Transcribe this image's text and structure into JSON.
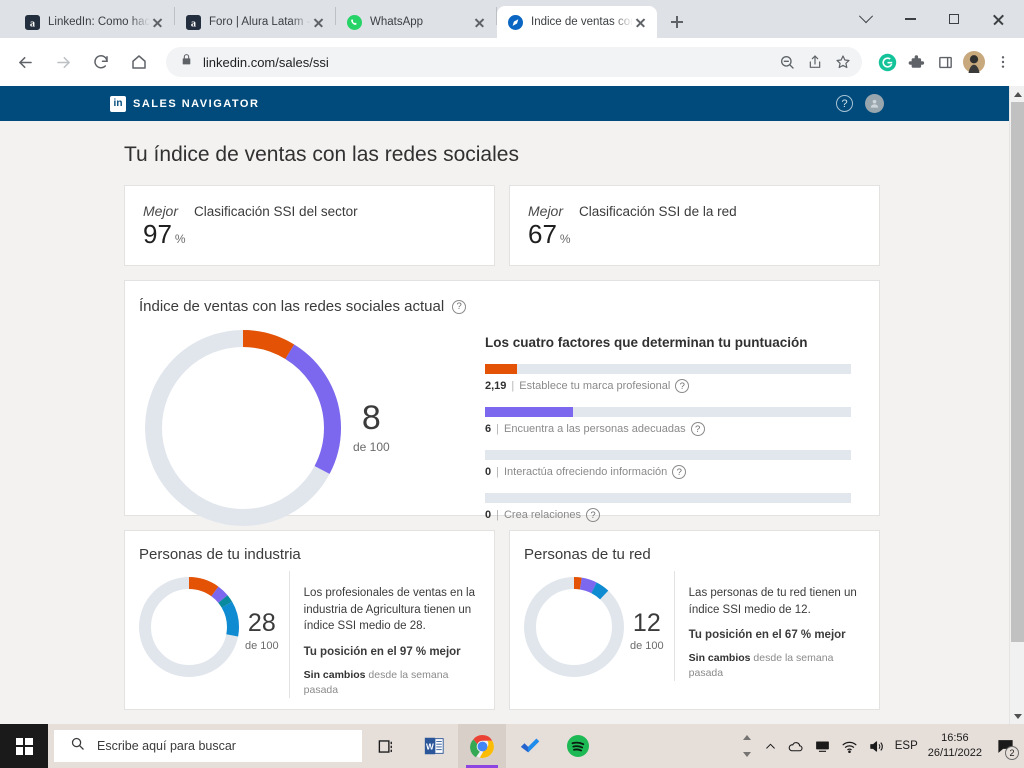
{
  "browser": {
    "tabs": [
      {
        "title": "LinkedIn: Como hacer c",
        "favicon": "amazon-a-icon",
        "active": false
      },
      {
        "title": "Foro | Alura Latam - Cu",
        "favicon": "amazon-a-icon",
        "active": false
      },
      {
        "title": "WhatsApp",
        "favicon": "whatsapp-icon",
        "active": false
      },
      {
        "title": "Índice de ventas con la",
        "favicon": "linkedin-sales-icon",
        "active": true
      }
    ],
    "window_controls": {
      "tab_search": "tab-search-chevron",
      "minimize": "minimize",
      "maximize": "maximize",
      "close": "close"
    },
    "nav": {
      "back": "back-arrow",
      "forward": "forward-arrow",
      "reload": "reload",
      "home": "home"
    },
    "omnibox": {
      "lock": "lock-icon",
      "url": "linkedin.com/sales/ssi"
    },
    "omnibox_icons": [
      "zoom-out-icon",
      "share-icon",
      "bookmark-star-icon"
    ],
    "extension_icons": [
      "grammarly-icon",
      "extensions-puzzle-icon",
      "sidepanel-icon",
      "profile-avatar",
      "chrome-menu-icon"
    ]
  },
  "sales_navigator": {
    "brand": "SALES NAVIGATOR",
    "logo_text": "in",
    "help_icon": "question-mark-icon",
    "account_icon": "account-avatar-icon"
  },
  "page": {
    "title": "Tu índice de ventas con las redes sociales",
    "rankings": [
      {
        "mejor": "Mejor",
        "label": "Clasificación SSI del sector",
        "value": "97",
        "unit": "%"
      },
      {
        "mejor": "Mejor",
        "label": "Clasificación SSI de la red",
        "value": "67",
        "unit": "%"
      }
    ],
    "ssi": {
      "heading": "Índice de ventas con las redes sociales actual",
      "help_icon": "question-mark-icon",
      "score": "8",
      "score_of": "de 100",
      "factors_heading": "Los cuatro factores que determinan tu puntuación",
      "factors": [
        {
          "value": "2,19",
          "sep": "|",
          "label": "Establece tu marca profesional",
          "color": "#e35205",
          "pct": 8.75,
          "help_icon": "question-mark-icon"
        },
        {
          "value": "6",
          "sep": "|",
          "label": "Encuentra a las personas adecuadas",
          "color": "#7b68ee",
          "pct": 24,
          "help_icon": "question-mark-icon"
        },
        {
          "value": "0",
          "sep": "|",
          "label": "Interactúa ofreciendo información",
          "color": "#0a8a9f",
          "pct": 0,
          "help_icon": "question-mark-icon"
        },
        {
          "value": "0",
          "sep": "|",
          "label": "Crea relaciones",
          "color": "#0f8bd1",
          "pct": 0,
          "help_icon": "question-mark-icon"
        }
      ]
    },
    "people": [
      {
        "heading": "Personas de tu industria",
        "score": "28",
        "score_of": "de 100",
        "line1": "Los profesionales de ventas en la industria de Agricultura tienen un índice SSI medio de 28.",
        "line2": "Tu posición en el 97 % mejor",
        "line3_bold": "Sin cambios",
        "line3_rest": " desde la semana pasada",
        "segments": [
          {
            "color": "#e35205",
            "pct": 10
          },
          {
            "color": "#7b68ee",
            "pct": 4
          },
          {
            "color": "#0a8a9f",
            "pct": 2.5
          },
          {
            "color": "#0f8bd1",
            "pct": 11.5
          }
        ]
      },
      {
        "heading": "Personas de tu red",
        "score": "12",
        "score_of": "de 100",
        "line1": "Las personas de tu red tienen un índice SSI medio de 12.",
        "line2": "Tu posición en el 67 % mejor",
        "line3_bold": "Sin cambios",
        "line3_rest": " desde la semana pasada",
        "segments": [
          {
            "color": "#e35205",
            "pct": 2.5
          },
          {
            "color": "#7b68ee",
            "pct": 5
          },
          {
            "color": "#0f8bd1",
            "pct": 4.5
          }
        ]
      }
    ]
  },
  "chart_data": [
    {
      "type": "pie",
      "title": "Índice de ventas con las redes sociales actual",
      "total_label": "de 100",
      "center_value": 8,
      "ylim": [
        0,
        100
      ],
      "categories": [
        "Establece tu marca profesional",
        "Encuentra a las personas adecuadas",
        "Interactúa ofreciendo información",
        "Crea relaciones",
        "Restante"
      ],
      "values": [
        2.19,
        6,
        0,
        0,
        91.81
      ],
      "colors": [
        "#e35205",
        "#7b68ee",
        "#0a8a9f",
        "#0f8bd1",
        "#dfe4ea"
      ]
    },
    {
      "type": "bar",
      "title": "Los cuatro factores que determinan tu puntuación",
      "categories": [
        "Establece tu marca profesional",
        "Encuentra a las personas adecuadas",
        "Interactúa ofreciendo información",
        "Crea relaciones"
      ],
      "values": [
        2.19,
        6,
        0,
        0
      ],
      "xlabel": "",
      "ylabel": "",
      "ylim": [
        0,
        25
      ],
      "colors": [
        "#e35205",
        "#7b68ee",
        "#0a8a9f",
        "#0f8bd1"
      ],
      "grid": false,
      "legend": "none"
    },
    {
      "type": "pie",
      "title": "Personas de tu industria",
      "center_value": 28,
      "total_label": "de 100",
      "categories": [
        "Establece tu marca profesional",
        "Encuentra a las personas adecuadas",
        "Interactúa ofreciendo información",
        "Crea relaciones",
        "Restante"
      ],
      "values": [
        10,
        4,
        2.5,
        11.5,
        72
      ],
      "colors": [
        "#e35205",
        "#7b68ee",
        "#0a8a9f",
        "#0f8bd1",
        "#dfe4ea"
      ]
    },
    {
      "type": "pie",
      "title": "Personas de tu red",
      "center_value": 12,
      "total_label": "de 100",
      "categories": [
        "Establece tu marca profesional",
        "Encuentra a las personas adecuadas",
        "Crea relaciones",
        "Restante"
      ],
      "values": [
        2.5,
        5,
        4.5,
        88
      ],
      "colors": [
        "#e35205",
        "#7b68ee",
        "#0f8bd1",
        "#dfe4ea"
      ]
    }
  ],
  "taskbar": {
    "start": "windows-logo",
    "search_placeholder": "Escribe aquí para buscar",
    "search_icon": "search-icon",
    "pinned": [
      "task-view-icon",
      "word-icon",
      "chrome-icon",
      "todo-icon",
      "spotify-icon"
    ],
    "tray": [
      "show-hidden-icons-chevron",
      "onedrive-icon",
      "display-icon",
      "wifi-icon",
      "volume-icon"
    ],
    "language": "ESP",
    "time": "16:56",
    "date": "26/11/2022",
    "notifications": "2",
    "notification_icon": "action-center-icon"
  }
}
